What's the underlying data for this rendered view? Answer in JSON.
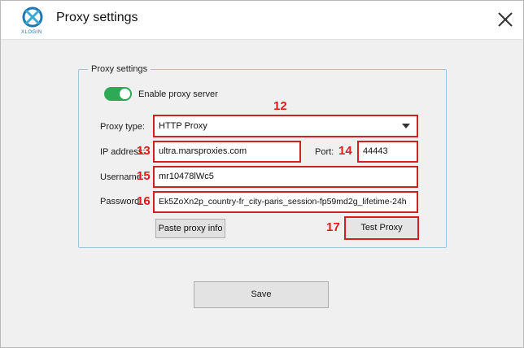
{
  "window": {
    "title": "Proxy settings",
    "logo_text": "XLOGIN"
  },
  "group": {
    "legend": "Proxy settings"
  },
  "enable_proxy": {
    "label": "Enable proxy server",
    "enabled": true
  },
  "proxy_type": {
    "label": "Proxy type:",
    "value": "HTTP Proxy"
  },
  "ip_address": {
    "label": "IP address:",
    "value": "ultra.marsproxies.com"
  },
  "port": {
    "label": "Port:",
    "value": "44443"
  },
  "username": {
    "label": "Username:",
    "value": "mr10478lWc5"
  },
  "password": {
    "label": "Password:",
    "value": "Ek5ZoXn2p_country-fr_city-paris_session-fp59md2g_lifetime-24h"
  },
  "buttons": {
    "paste": "Paste proxy info",
    "test": "Test Proxy",
    "save": "Save"
  },
  "annotations": {
    "proxy_type": "12",
    "ip_address": "13",
    "port": "14",
    "username": "15",
    "password": "16",
    "test": "17"
  },
  "colors": {
    "toggle_on": "#2eaa57",
    "highlight": "#d21f1f",
    "annotation": "#e01b1b"
  }
}
